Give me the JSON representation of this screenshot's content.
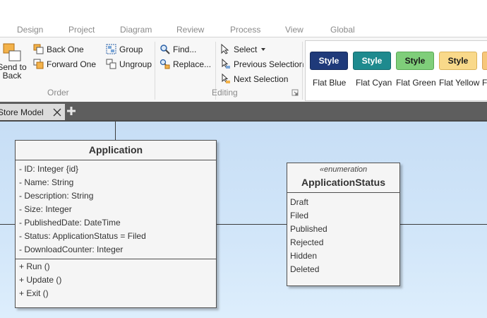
{
  "ribbon_tabs": [
    "Design",
    "Project",
    "Diagram",
    "Review",
    "Process",
    "View",
    "Global"
  ],
  "order_group": {
    "send_to_back": "Send to\nBack",
    "back_one": "Back One",
    "forward_one": "Forward One",
    "label": "Order"
  },
  "group_group": {
    "group": "Group",
    "ungroup": "Ungroup"
  },
  "editing_group": {
    "find": "Find...",
    "replace": "Replace...",
    "select": "Select",
    "previous_selection": "Previous Selection",
    "next_selection": "Next Selection",
    "label": "Editing"
  },
  "styles": [
    {
      "button": "Style",
      "label": "Flat Blue",
      "bg": "#1f3a7a",
      "fg": "#ffffff",
      "border": "#14295a"
    },
    {
      "button": "Style",
      "label": "Flat Cyan",
      "bg": "#1e8a8e",
      "fg": "#ffffff",
      "border": "#146a6d"
    },
    {
      "button": "Style",
      "label": "Flat Green",
      "bg": "#7fce7a",
      "fg": "#1a1a1a",
      "border": "#5aa855"
    },
    {
      "button": "Style",
      "label": "Flat Yellow",
      "bg": "#f9d98a",
      "fg": "#1a1a1a",
      "border": "#d9b25a"
    },
    {
      "button": "",
      "label": "F",
      "bg": "#f7c77a",
      "fg": "#1a1a1a",
      "border": "#d9a55a"
    }
  ],
  "document_tab": {
    "title": "Store Model"
  },
  "diagram": {
    "application": {
      "name": "Application",
      "attributes": [
        "- ID: Integer {id}",
        "- Name: String",
        "- Description: String",
        "- Size: Integer",
        "- PublishedDate: DateTime",
        "- Status: ApplicationStatus = Filed",
        "- DownloadCounter: Integer"
      ],
      "operations": [
        "+ Run ()",
        "+ Update ()",
        "+ Exit ()"
      ]
    },
    "status": {
      "stereotype": "«enumeration",
      "name": "ApplicationStatus",
      "literals": [
        "Draft",
        "Filed",
        "Published",
        "Rejected",
        "Hidden",
        "Deleted"
      ]
    }
  },
  "colors": {
    "canvas": "#cfe3f7",
    "class_fill": "#f5f5f5",
    "class_border": "#4f4f4f"
  }
}
